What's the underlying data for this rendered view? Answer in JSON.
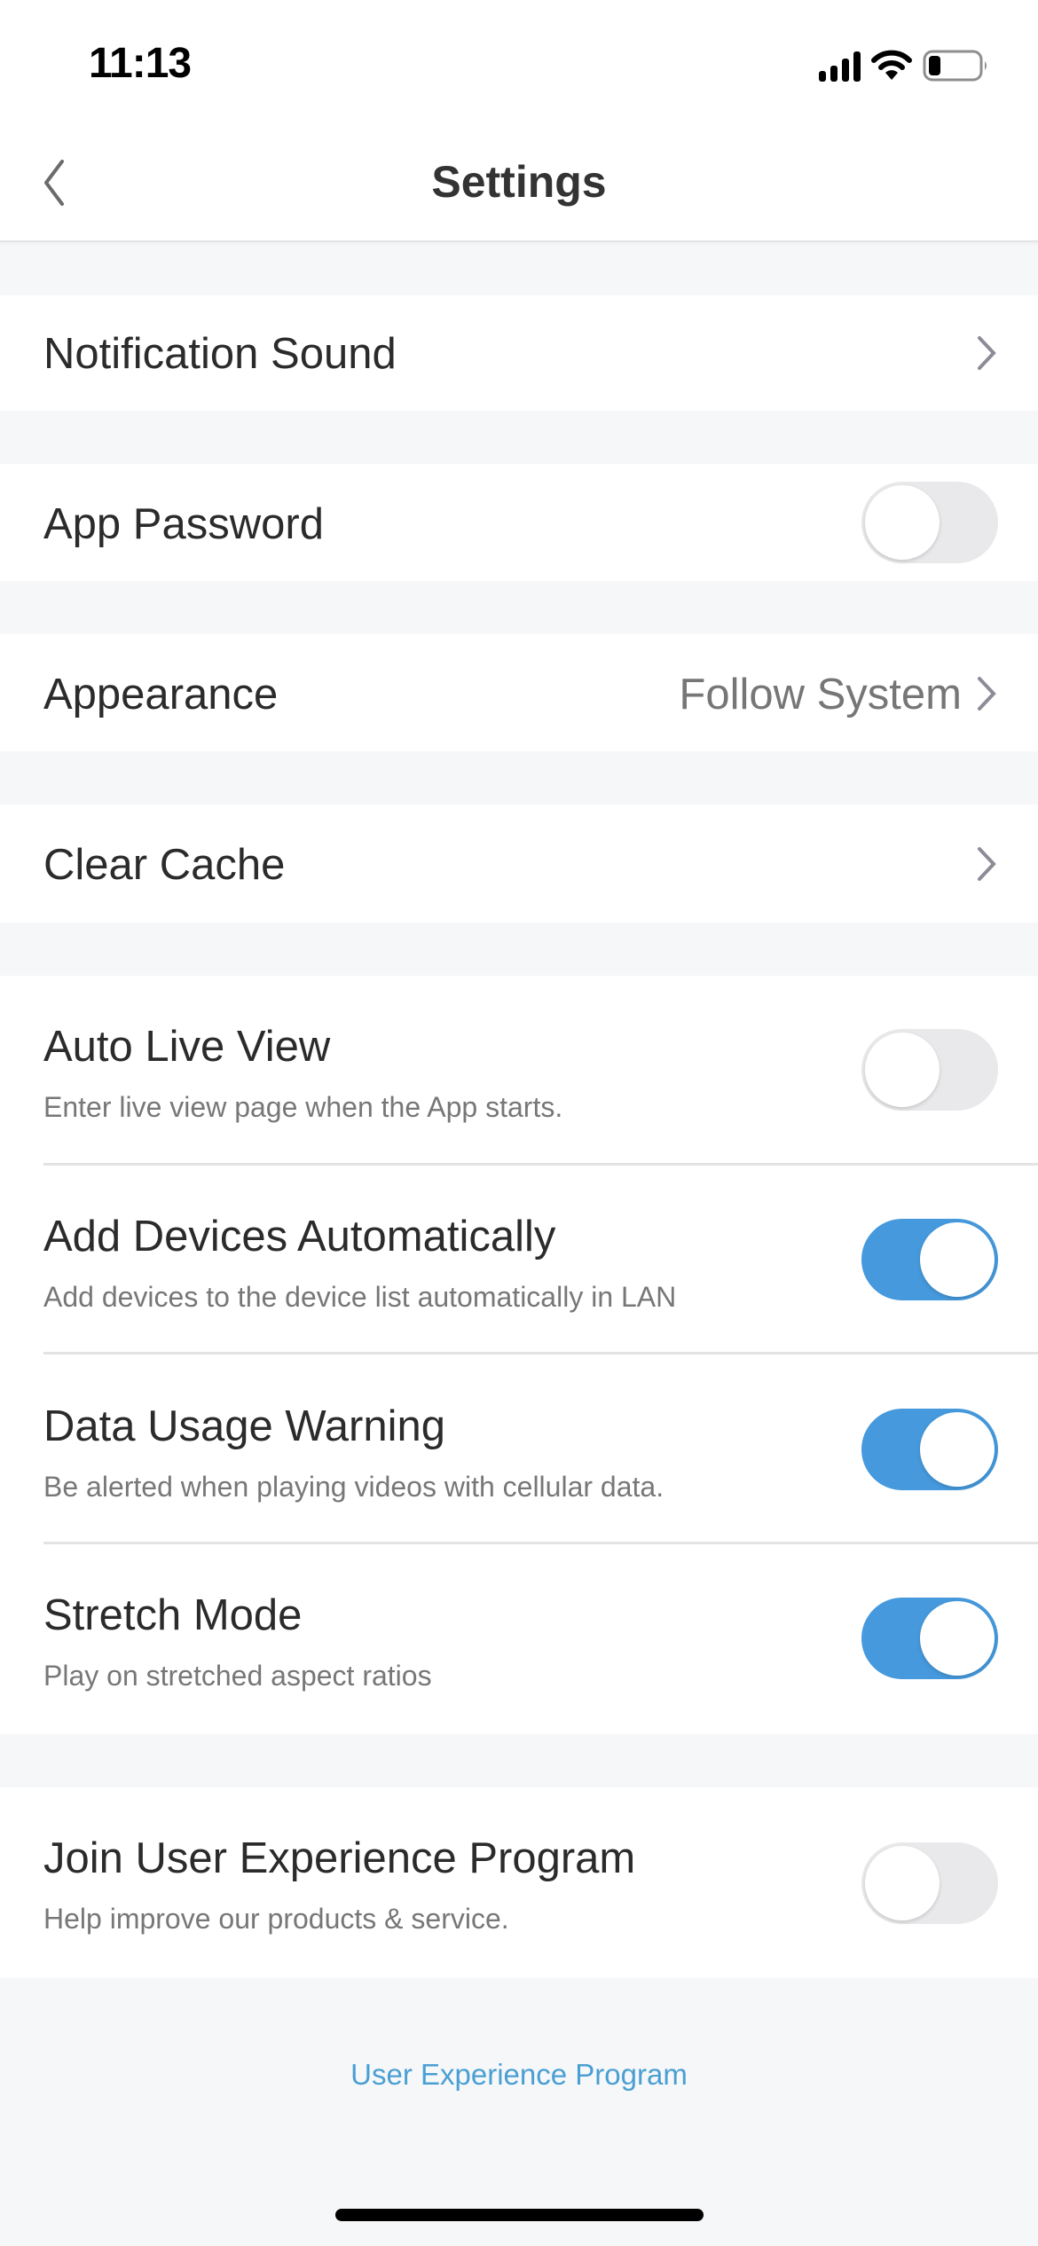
{
  "status_bar": {
    "time": "11:13",
    "icons": [
      "cellular-signal-icon",
      "wifi-icon",
      "battery-icon"
    ],
    "battery_level": 0.2
  },
  "nav": {
    "title": "Settings",
    "back_icon": "chevron-left-icon"
  },
  "groups": [
    {
      "rows": [
        {
          "label": "Notification Sound",
          "type": "link"
        }
      ]
    },
    {
      "rows": [
        {
          "label": "App Password",
          "type": "toggle",
          "on": false
        }
      ]
    },
    {
      "rows": [
        {
          "label": "Appearance",
          "type": "link",
          "value": "Follow System"
        }
      ]
    },
    {
      "rows": [
        {
          "label": "Clear Cache",
          "type": "link"
        }
      ]
    },
    {
      "rows": [
        {
          "label": "Auto Live View",
          "subtitle": "Enter live view page when the App starts.",
          "type": "toggle",
          "on": false
        },
        {
          "label": "Add Devices Automatically",
          "subtitle": "Add devices to the device list automatically in LAN",
          "type": "toggle",
          "on": true
        },
        {
          "label": "Data Usage Warning",
          "subtitle": "Be alerted when playing videos with cellular data.",
          "type": "toggle",
          "on": true
        },
        {
          "label": "Stretch Mode",
          "subtitle": "Play on stretched aspect ratios",
          "type": "toggle",
          "on": true
        }
      ]
    },
    {
      "rows": [
        {
          "label": "Join User Experience Program",
          "subtitle": "Help improve our products & service.",
          "type": "toggle",
          "on": false
        }
      ]
    }
  ],
  "footer": {
    "link_label": "User Experience Program"
  },
  "colors": {
    "accent": "#4599dc",
    "link": "#4a9fd3",
    "background": "#f6f7f9",
    "toggle_off": "#e9e9eb"
  }
}
